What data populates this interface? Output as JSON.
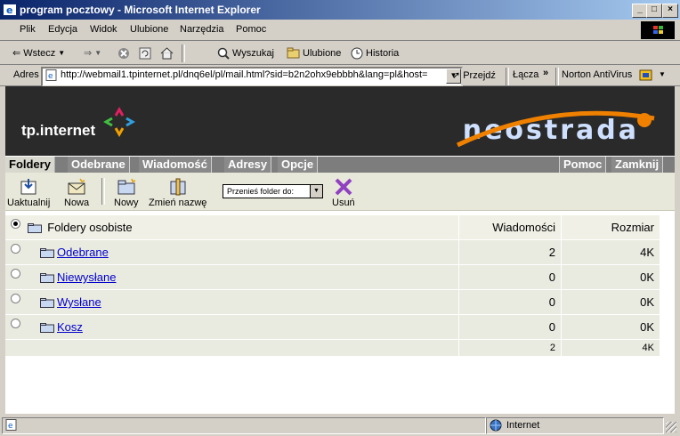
{
  "window": {
    "title": "program pocztowy - Microsoft Internet Explorer"
  },
  "menu": [
    "Plik",
    "Edycja",
    "Widok",
    "Ulubione",
    "Narzędzia",
    "Pomoc"
  ],
  "toolbar": {
    "back": "Wstecz",
    "search": "Wyszukaj",
    "favorites": "Ulubione",
    "history": "Historia"
  },
  "address": {
    "label": "Adres",
    "url": "http://webmail1.tpinternet.pl/dnq6el/pl/mail.html?sid=b2n2ohx9ebbbh&lang=pl&host=",
    "go": "Przejdź",
    "links": "Łącza",
    "antivirus": "Norton AntiVirus"
  },
  "banner": {
    "left_logo": "tp.internet",
    "right_logo": "neostrada"
  },
  "tabs": [
    "Foldery",
    "Odebrane",
    "Wiadomość",
    "Adresy",
    "Opcje"
  ],
  "tabs_right": [
    "Pomoc",
    "Zamknij"
  ],
  "actions": {
    "refresh": "Uaktualnij",
    "new_msg": "Nowa",
    "new_folder": "Nowy",
    "rename": "Zmień nazwę",
    "move_placeholder": "Przenieś folder do:",
    "delete": "Usuń"
  },
  "table": {
    "root": "Foldery osobiste",
    "col_messages": "Wiadomości",
    "col_size": "Rozmiar",
    "rows": [
      {
        "name": "Odebrane",
        "messages": "2",
        "size": "4K"
      },
      {
        "name": "Niewysłane",
        "messages": "0",
        "size": "0K"
      },
      {
        "name": "Wysłane",
        "messages": "0",
        "size": "0K"
      },
      {
        "name": "Kosz",
        "messages": "0",
        "size": "0K"
      }
    ],
    "total": {
      "messages": "2",
      "size": "4K"
    }
  },
  "status": {
    "zone": "Internet"
  }
}
